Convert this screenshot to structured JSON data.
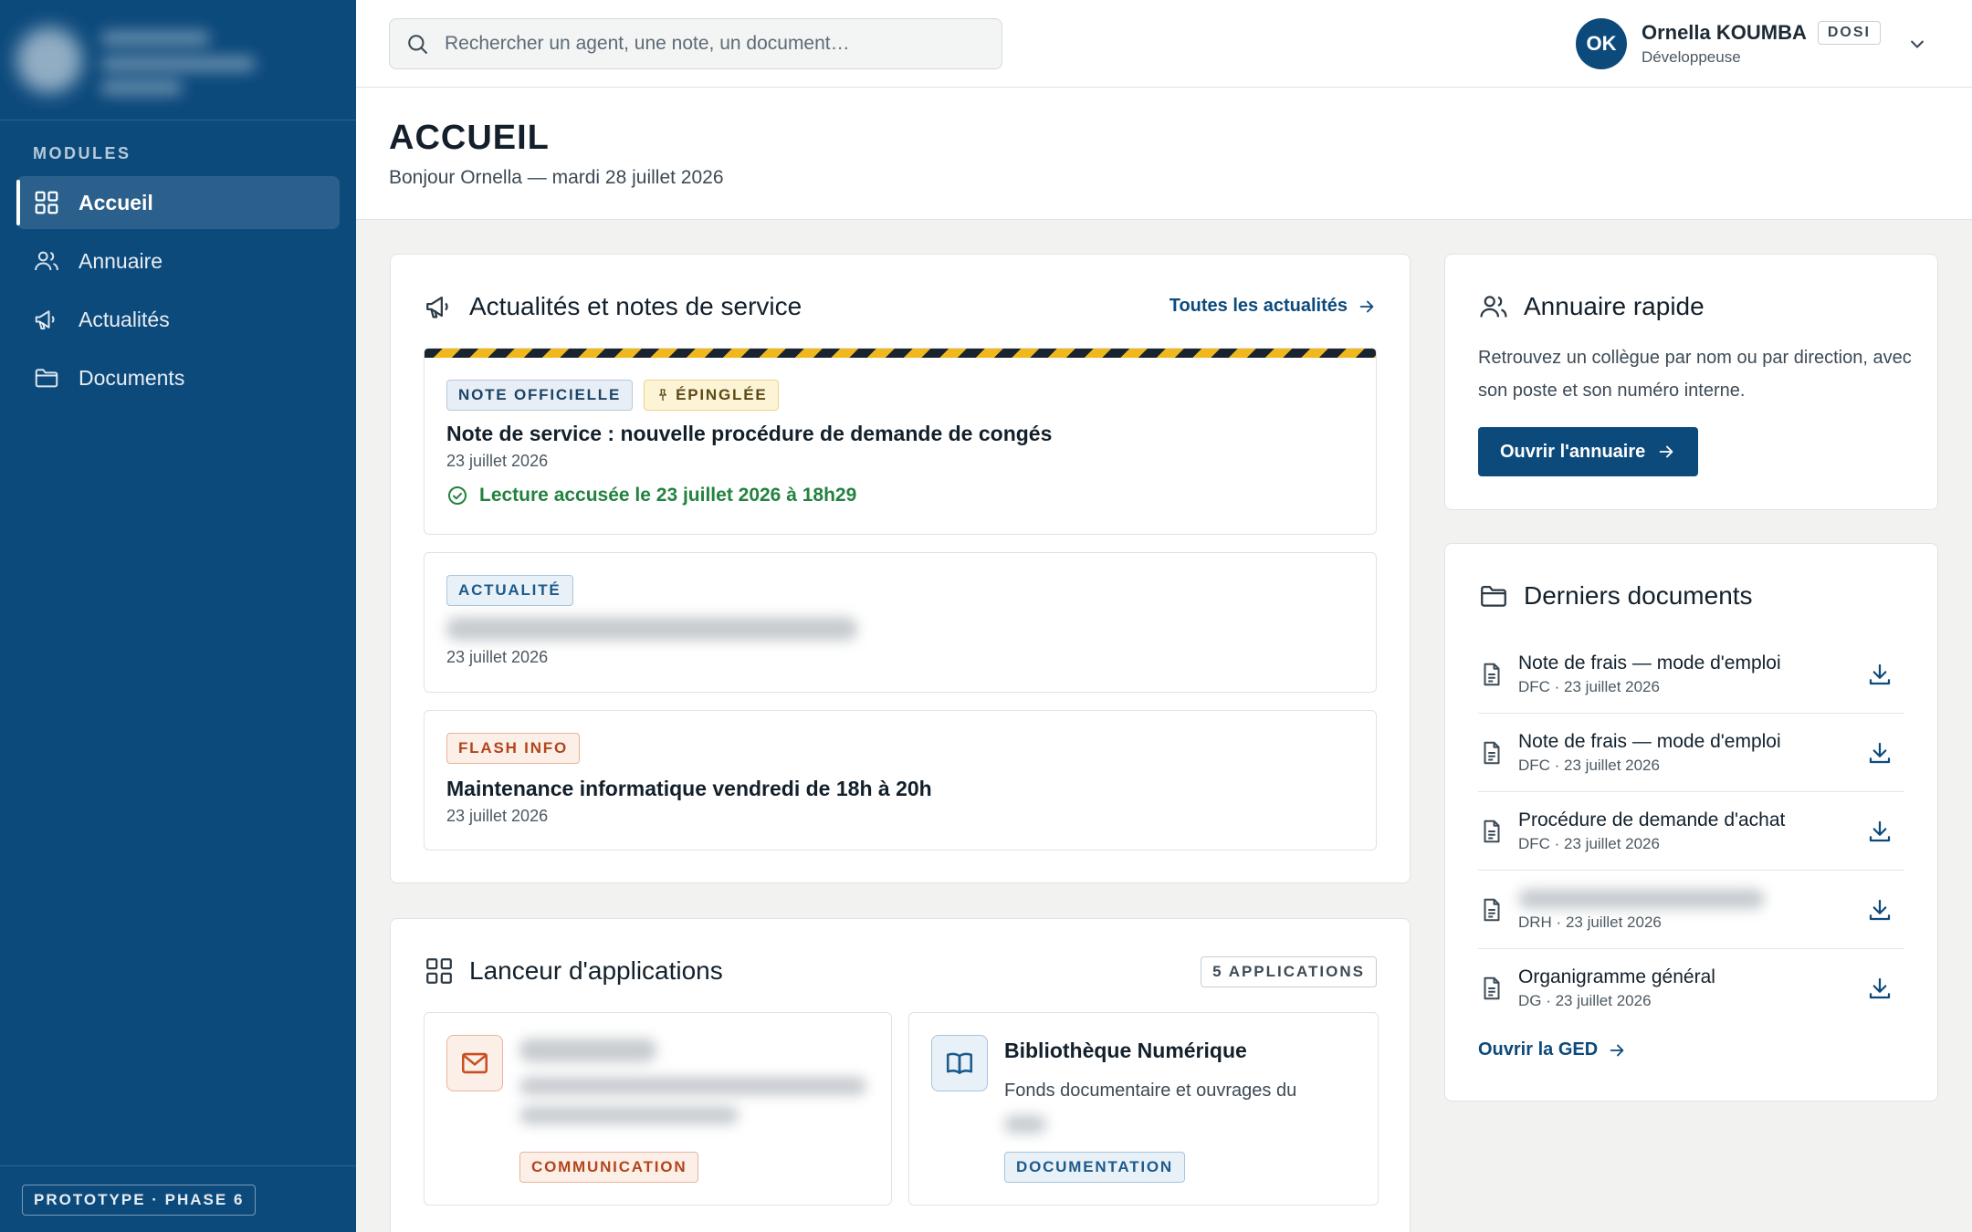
{
  "sidebar": {
    "section_label": "MODULES",
    "items": [
      {
        "label": "Accueil",
        "icon": "grid-icon",
        "active": true
      },
      {
        "label": "Annuaire",
        "icon": "users-icon",
        "active": false
      },
      {
        "label": "Actualités",
        "icon": "megaphone-icon",
        "active": false
      },
      {
        "label": "Documents",
        "icon": "folder-icon",
        "active": false
      }
    ],
    "footer_badge": "PROTOTYPE · PHASE 6"
  },
  "topbar": {
    "search_placeholder": "Rechercher un agent, une note, un document…",
    "user": {
      "initials": "OK",
      "name": "Ornella KOUMBA",
      "department": "DOSI",
      "role": "Développeuse"
    }
  },
  "page": {
    "title": "ACCUEIL",
    "subtitle": "Bonjour Ornella — mardi 28 juillet 2026"
  },
  "news": {
    "title": "Actualités et notes de service",
    "all_link": "Toutes les actualités",
    "items": [
      {
        "tags": [
          "NOTE OFFICIELLE",
          "ÉPINGLÉE"
        ],
        "title": "Note de service : nouvelle procédure de demande de congés",
        "date": "23 juillet 2026",
        "ack": "Lecture accusée le 23 juillet 2026 à 18h29"
      },
      {
        "tags": [
          "ACTUALITÉ"
        ],
        "date": "23 juillet 2026"
      },
      {
        "tags": [
          "FLASH INFO"
        ],
        "title": "Maintenance informatique vendredi de 18h à 20h",
        "date": "23 juillet 2026"
      }
    ]
  },
  "apps": {
    "title": "Lanceur d'applications",
    "count": "5 APPLICATIONS",
    "tiles": [
      {
        "icon": "mail-icon",
        "category": "COMMUNICATION",
        "accent": "#c84f22"
      },
      {
        "icon": "book-icon",
        "name": "Bibliothèque Numérique",
        "description": "Fonds documentaire et ouvrages du",
        "category": "DOCUMENTATION",
        "accent": "#1d5a8a"
      }
    ]
  },
  "directory": {
    "title": "Annuaire rapide",
    "description": "Retrouvez un collègue par nom ou par direction, avec son poste et son numéro interne.",
    "button": "Ouvrir l'annuaire"
  },
  "documents": {
    "title": "Derniers documents",
    "items": [
      {
        "title": "Note de frais — mode d'emploi",
        "meta": "DFC · 23 juillet 2026"
      },
      {
        "title": "Note de frais — mode d'emploi",
        "meta": "DFC · 23 juillet 2026"
      },
      {
        "title": "Procédure de demande d'achat",
        "meta": "DFC · 23 juillet 2026"
      },
      {
        "title": "",
        "meta": "DRH · 23 juillet 2026"
      },
      {
        "title": "Organigramme général",
        "meta": "DG · 23 juillet 2026"
      }
    ],
    "link": "Ouvrir la GED"
  },
  "colors": {
    "primary": "#0d4a7c",
    "success": "#23823f",
    "flash": "#c84f22",
    "pinned": "#f0b81c"
  }
}
